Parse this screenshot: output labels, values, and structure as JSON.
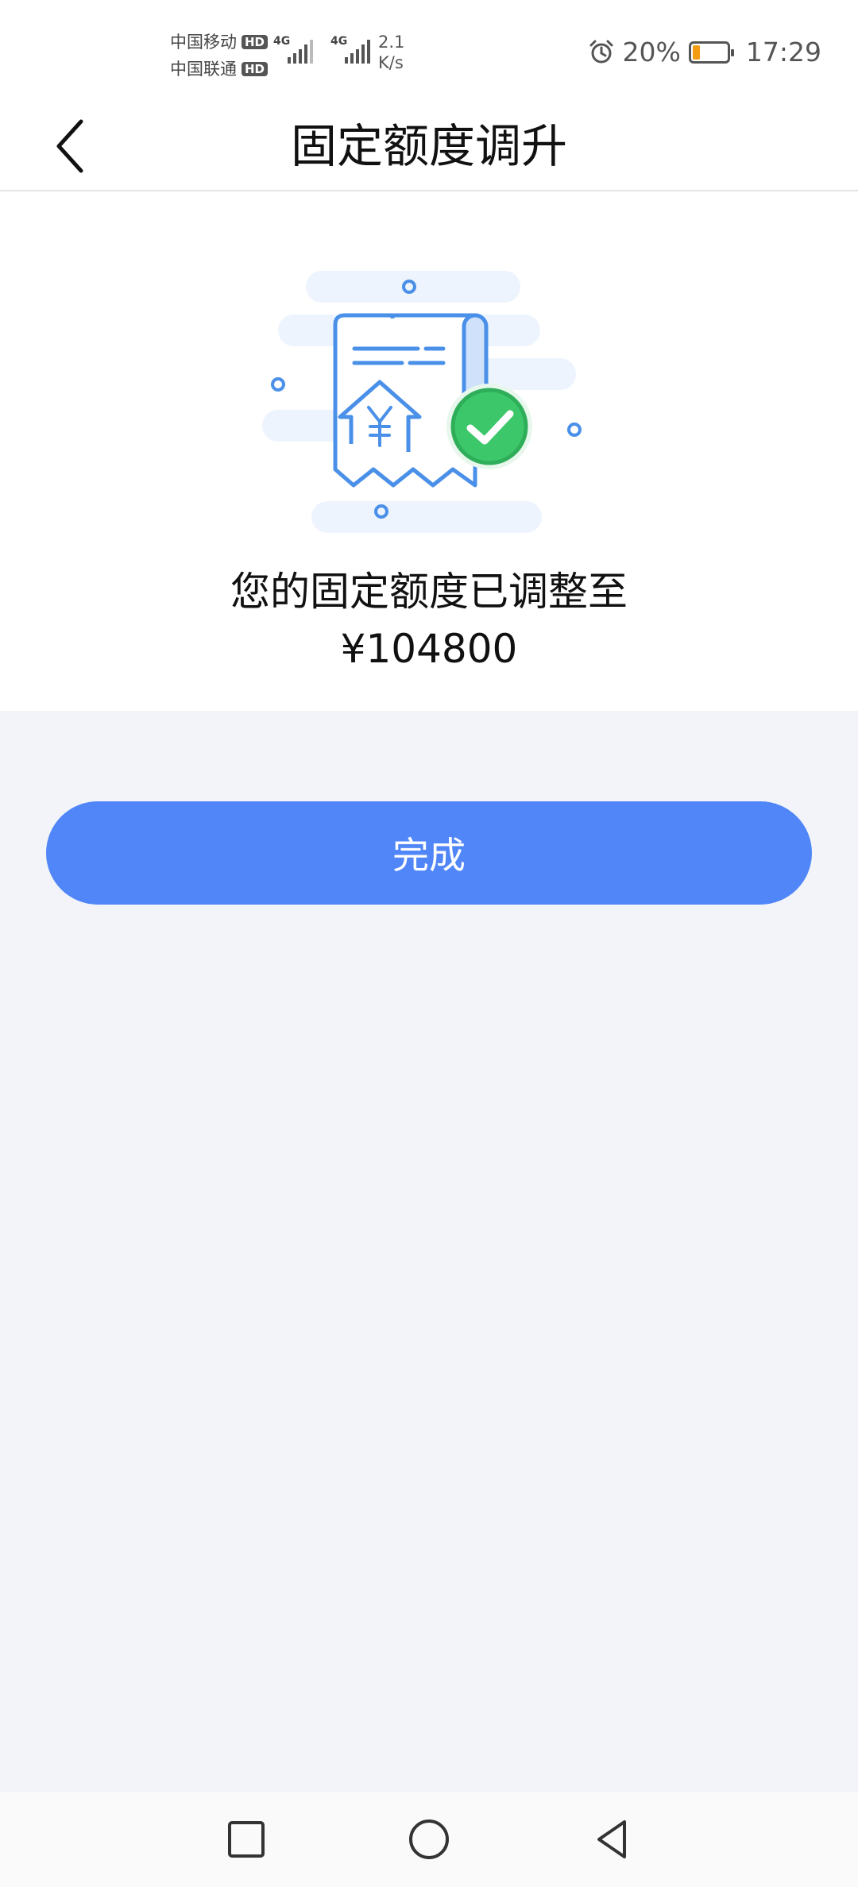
{
  "status_bar": {
    "carrier_1": "中国移动",
    "carrier_2": "中国联通",
    "hd_badge": "HD",
    "network_type": "4G",
    "net_speed_value": "2.1",
    "net_speed_unit": "K/s",
    "battery_percent": "20%",
    "battery_level": 0.2,
    "time": "17:29"
  },
  "header": {
    "title": "固定额度调升",
    "back_icon": "chevron-left-icon"
  },
  "result": {
    "illustration_icon": "receipt-yuan-check-icon",
    "message": "您的固定额度已调整至",
    "amount": "¥104800"
  },
  "actions": {
    "done_label": "完成"
  },
  "system_nav": {
    "recents_icon": "square-icon",
    "home_icon": "circle-icon",
    "back_icon": "triangle-back-icon"
  },
  "colors": {
    "accent": "#5086f8",
    "success": "#3cc76a",
    "battery_low": "#f39c12"
  }
}
